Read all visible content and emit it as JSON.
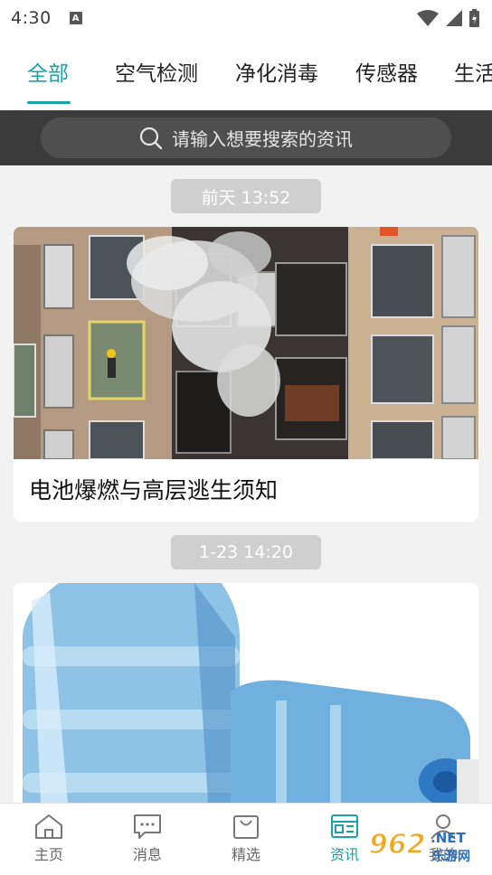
{
  "status_bar": {
    "time": "4:30",
    "indicator": "A",
    "icons": [
      "wifi-icon",
      "signal-icon",
      "battery-icon"
    ]
  },
  "tabs": [
    {
      "label": "全部",
      "active": true
    },
    {
      "label": "空气检测",
      "active": false
    },
    {
      "label": "净化消毒",
      "active": false
    },
    {
      "label": "传感器",
      "active": false
    },
    {
      "label": "生活",
      "active": false
    }
  ],
  "search": {
    "placeholder": "请输入想要搜索的资讯",
    "icon": "search-icon"
  },
  "feed": [
    {
      "time": "前天 13:52",
      "title": "电池爆燃与高层逃生须知",
      "image": "building-fire-image"
    },
    {
      "time": "1-23 14:20",
      "title": "",
      "image": "water-bottles-image"
    }
  ],
  "bottom_nav": [
    {
      "label": "主页",
      "icon": "home-icon",
      "active": false
    },
    {
      "label": "消息",
      "icon": "message-icon",
      "active": false
    },
    {
      "label": "精选",
      "icon": "bag-icon",
      "active": false
    },
    {
      "label": "资讯",
      "icon": "news-icon",
      "active": true
    },
    {
      "label": "我的",
      "icon": "user-icon",
      "active": false
    }
  ],
  "watermark": {
    "brand": "962",
    "suffix": ".NET",
    "sub": "乐游网"
  },
  "colors": {
    "accent": "#19a3a9",
    "search_band": "#3b3b3b",
    "pill": "#cfcfcf"
  }
}
